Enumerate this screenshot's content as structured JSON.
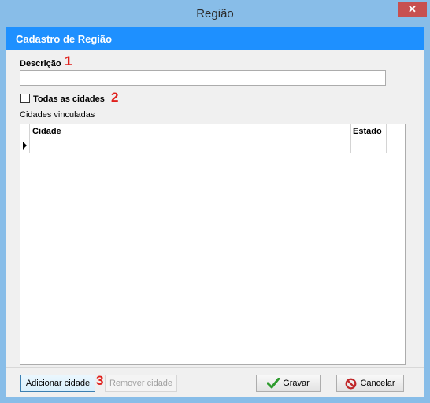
{
  "window": {
    "title": "Região",
    "close_glyph": "✕"
  },
  "header": {
    "title": "Cadastro de Região"
  },
  "form": {
    "descricao_label": "Descrição",
    "descricao_value": "",
    "todas_label": "Todas as cidades",
    "todas_checked": false,
    "vinculadas_label": "Cidades vinculadas"
  },
  "markers": {
    "m1": "1",
    "m2": "2",
    "m3": "3"
  },
  "grid": {
    "columns": [
      "Cidade",
      "Estado"
    ],
    "rows": [
      {
        "cidade": "",
        "estado": ""
      }
    ]
  },
  "buttons": {
    "adicionar": "Adicionar cidade",
    "remover": "Remover cidade",
    "gravar": "Gravar",
    "cancelar": "Cancelar"
  },
  "icons": {
    "check": "check-icon",
    "cancel": "no-entry-icon"
  },
  "colors": {
    "header": "#1e90ff",
    "titlebar": "#88bde8",
    "marker": "#e0201c",
    "check_green": "#2e9b2e",
    "cancel_red": "#c0282a"
  }
}
